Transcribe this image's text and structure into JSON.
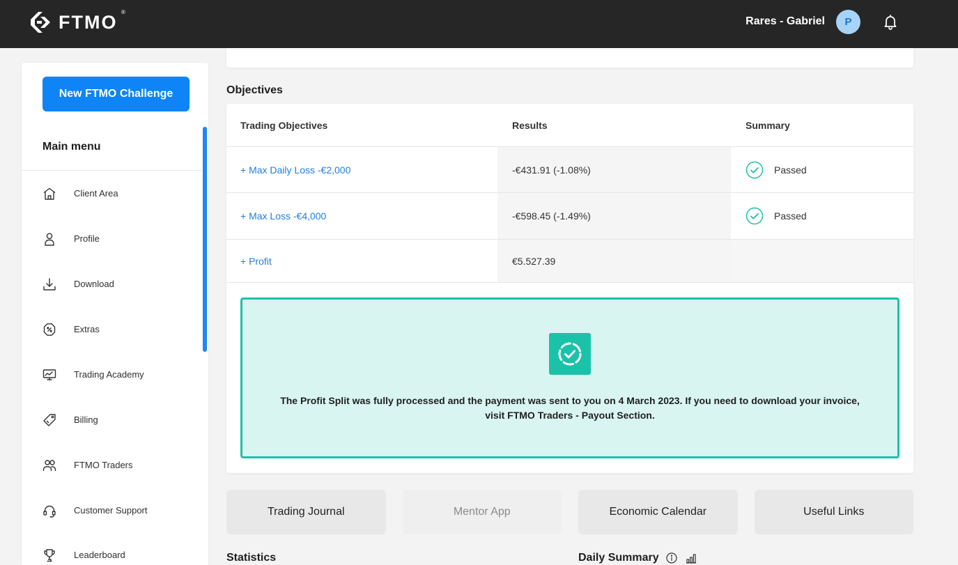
{
  "header": {
    "logo_text": "FTMO",
    "logo_registered": "®",
    "user_name": "Rares - Gabriel",
    "avatar_initial": "P",
    "icons": [
      "ftmo-logo-icon",
      "bell-icon"
    ]
  },
  "sidebar": {
    "cta_label": "New FTMO Challenge",
    "menu_title": "Main menu",
    "items": [
      {
        "label": "Client Area",
        "icon": "home-icon"
      },
      {
        "label": "Profile",
        "icon": "user-icon"
      },
      {
        "label": "Download",
        "icon": "download-icon"
      },
      {
        "label": "Extras",
        "icon": "discount-badge-icon"
      },
      {
        "label": "Trading Academy",
        "icon": "academy-icon"
      },
      {
        "label": "Billing",
        "icon": "tag-icon"
      },
      {
        "label": "FTMO Traders",
        "icon": "users-icon"
      },
      {
        "label": "Customer Support",
        "icon": "headset-icon"
      },
      {
        "label": "Leaderboard",
        "icon": "trophy-icon"
      }
    ]
  },
  "objectives": {
    "heading": "Objectives",
    "columns": {
      "objective": "Trading Objectives",
      "result": "Results",
      "summary": "Summary"
    },
    "rows": [
      {
        "objective": "+ Max Daily Loss -€2,000",
        "result": "-€431.91 (-1.08%)",
        "summary": "Passed",
        "status_icon": "check-circle-icon"
      },
      {
        "objective": "+ Max Loss -€4,000",
        "result": "-€598.45 (-1.49%)",
        "summary": "Passed",
        "status_icon": "check-circle-icon"
      },
      {
        "objective": "+ Profit",
        "result": "€5.527.39"
      }
    ]
  },
  "notice": {
    "icon": "processed-check-icon",
    "lines": [
      "The Profit Split was fully processed and the payment was sent to you on 4 March 2023. If you need to download your invoice,",
      "visit FTMO Traders - Payout Section."
    ]
  },
  "quick_links": [
    {
      "label": "Trading Journal"
    },
    {
      "label": "Mentor App",
      "disabled": true
    },
    {
      "label": "Economic Calendar"
    },
    {
      "label": "Useful Links"
    }
  ],
  "sections": {
    "statistics_title": "Statistics",
    "daily_summary_title": "Daily Summary",
    "daily_summary_icons": [
      "info-icon",
      "bar-chart-icon"
    ]
  },
  "colors": {
    "header_bg": "#262626",
    "brand_blue": "#0e84f6",
    "link_blue": "#1f7fe0",
    "success_teal": "#1cc1a8",
    "notice_bg": "#d8f5f2"
  }
}
